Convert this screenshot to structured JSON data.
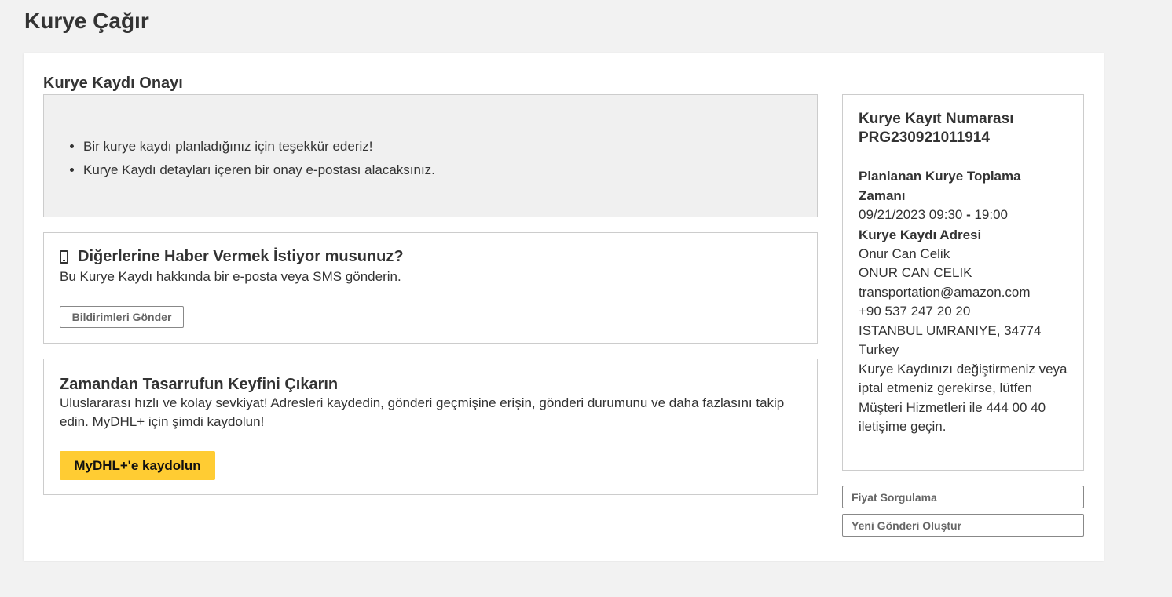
{
  "page_title": "Kurye Çağır",
  "confirmation": {
    "title": "Kurye Kaydı Onayı",
    "bullets": [
      "Bir kurye kaydı planladığınız için teşekkür ederiz!",
      "Kurye Kaydı detayları içeren bir onay e-postası alacaksınız."
    ]
  },
  "notify": {
    "icon": "mobile-phone-icon",
    "title": "Diğerlerine Haber Vermek İstiyor musunuz?",
    "description": "Bu Kurye Kaydı hakkında bir e-posta veya SMS gönderin.",
    "button_label": "Bildirimleri Gönder"
  },
  "promo": {
    "title": "Zamandan Tasarrufun Keyfini Çıkarın",
    "text": "Uluslararası hızlı ve kolay sevkiyat! Adresleri kaydedin, gönderi geçmişine erişin, gönderi durumunu ve daha fazlasını takip edin. MyDHL+ için şimdi kaydolun!",
    "button_label": "MyDHL+'e kaydolun",
    "button_color": "#ffcc33"
  },
  "summary": {
    "ref_label": "Kurye Kayıt Numarası",
    "ref_number": "PRG230921011914",
    "pickup_heading": "Planlanan Kurye Toplama Zamanı",
    "pickup_time": "09/21/2023 09:30",
    "pickup_sep": " - ",
    "pickup_end": "19:00",
    "address_heading": "Kurye Kaydı Adresi",
    "address_lines": [
      "Onur Can Celik",
      "ONUR CAN CELIK",
      "transportation@amazon.com",
      "+90 537 247 20 20",
      "ISTANBUL UMRANIYE, 34774",
      "Turkey"
    ],
    "help_text": "Kurye Kaydınızı değiştirmeniz veya iptal etmeniz gerekirse, lütfen Müşteri Hizmetleri ile 444 00 40 iletişime geçin."
  },
  "actions": {
    "price_quote": "Fiyat Sorgulama",
    "new_shipment": "Yeni Gönderi Oluştur"
  }
}
